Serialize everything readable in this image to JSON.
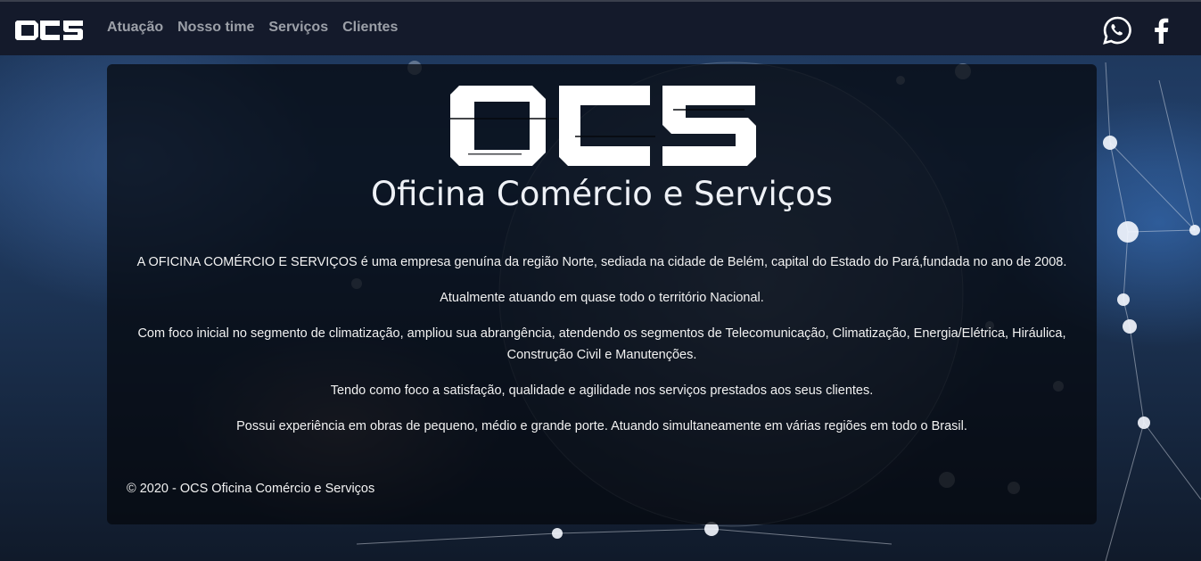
{
  "nav": {
    "brand_alt": "OCS",
    "links": [
      "Atuação",
      "Nosso time",
      "Serviços",
      "Clientes"
    ],
    "social": [
      {
        "icon": "whatsapp-icon"
      },
      {
        "icon": "facebook-icon"
      }
    ]
  },
  "hero": {
    "logo_text": "OCS",
    "title": "Oficina Comércio e Serviços",
    "paragraphs": [
      "A OFICINA COMÉRCIO E SERVIÇOS é uma empresa genuína da região Norte, sediada na cidade de Belém, capital do Estado do Pará,fundada no ano de 2008.",
      "Atualmente atuando em quase todo o território Nacional.",
      "Com foco inicial no segmento de climatização, ampliou sua abrangência, atendendo os segmentos de Telecomunicação, Climatização, Energia/Elétrica, Hiráulica, Construção Civil e Manutenções.",
      "Tendo como foco a satisfação, qualidade e agilidade nos serviços prestados aos seus clientes.",
      "Possui experiência em obras de pequeno, médio e grande porte. Atuando simultaneamente em várias regiões em todo o Brasil."
    ],
    "footer": "© 2020 - OCS Oficina Comércio e Serviços"
  },
  "colors": {
    "navbar": "#141a2b",
    "nav_link": "#9ca0a8",
    "card": "rgba(5,8,14,0.74)",
    "text": "#f2f2f2"
  }
}
